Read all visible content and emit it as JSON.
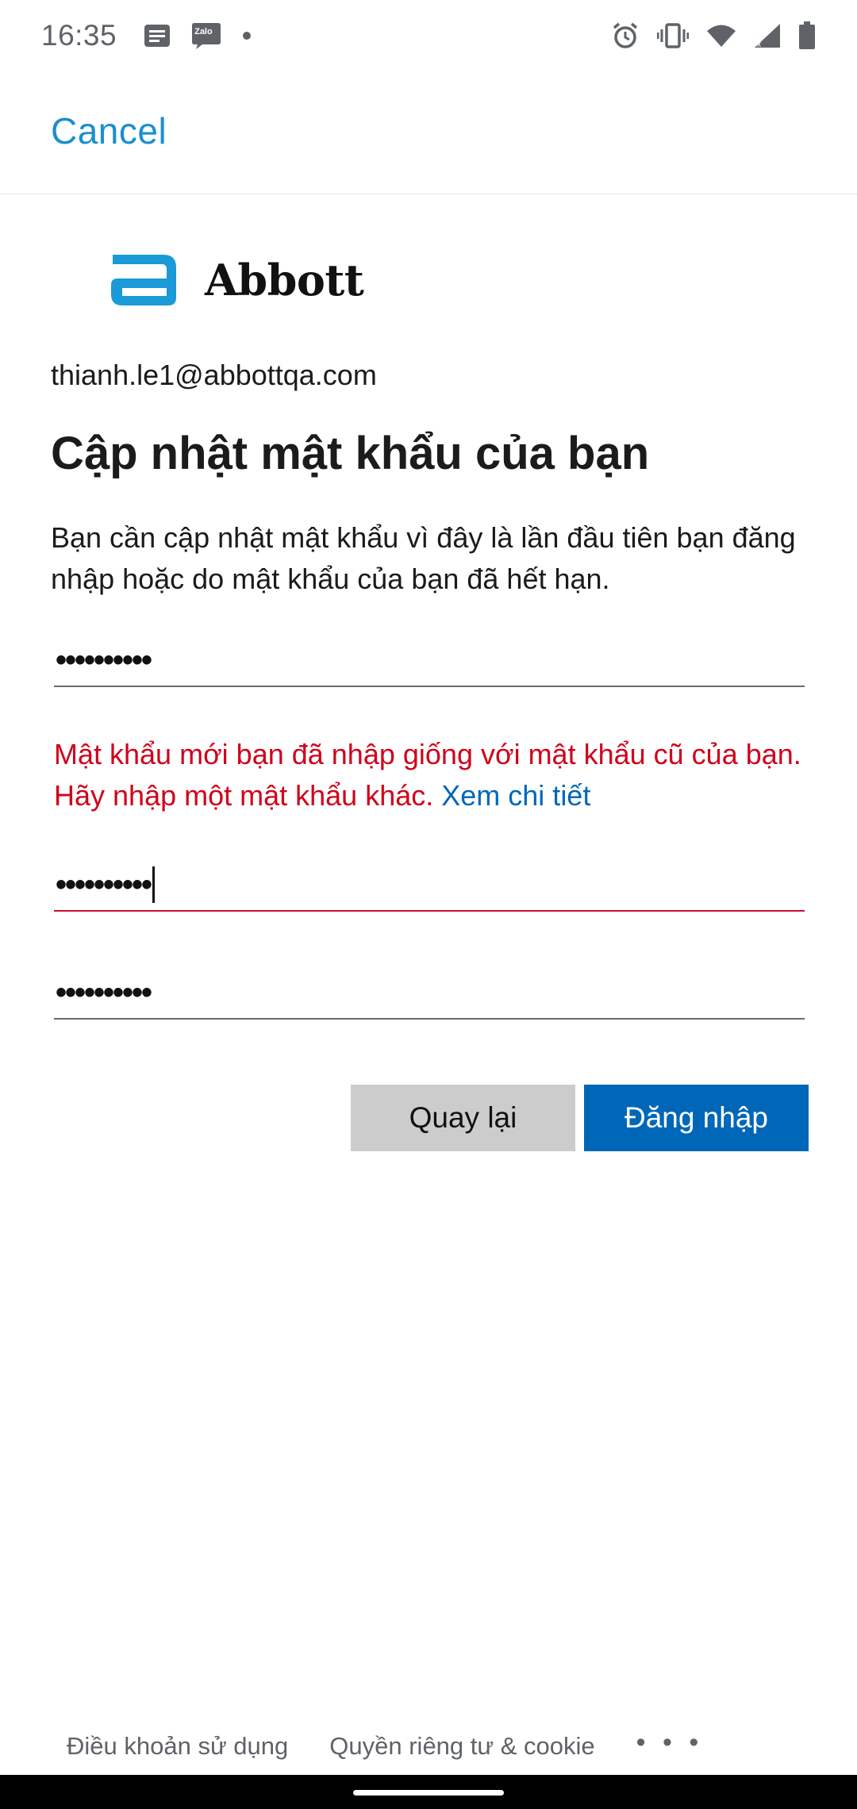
{
  "status_bar": {
    "time": "16:35",
    "left_icons": [
      "message-icon",
      "zalo-icon",
      "dot-icon"
    ],
    "zalo_label": "Zalo",
    "right_icons": [
      "alarm-icon",
      "vibrate-icon",
      "wifi-icon",
      "signal-icon",
      "battery-icon"
    ]
  },
  "header": {
    "cancel_label": "Cancel"
  },
  "logo": {
    "text": "Abbott",
    "brand_color": "#1a9ad6"
  },
  "account": {
    "email": "thianh.le1@abbottqa.com"
  },
  "page": {
    "title": "Cập nhật mật khẩu của bạn",
    "description": "Bạn cần cập nhật mật khẩu vì đây là lần đầu tiên bạn đăng nhập hoặc do mật khẩu của bạn đã hết hạn."
  },
  "fields": {
    "current_password": "••••••••••",
    "new_password": "••••••••••",
    "confirm_password": "••••••••••"
  },
  "error": {
    "message": "Mật khẩu mới bạn đã nhập giống với mật khẩu cũ của bạn. Hãy nhập một mật khẩu khác.",
    "link": "Xem chi tiết",
    "color": "#d0021b"
  },
  "buttons": {
    "back_label": "Quay lại",
    "signin_label": "Đăng nhập",
    "primary_color": "#0067b8"
  },
  "footer": {
    "terms_label": "Điều khoản sử dụng",
    "privacy_label": "Quyền riêng tư & cookie",
    "more_label": "• • •"
  }
}
